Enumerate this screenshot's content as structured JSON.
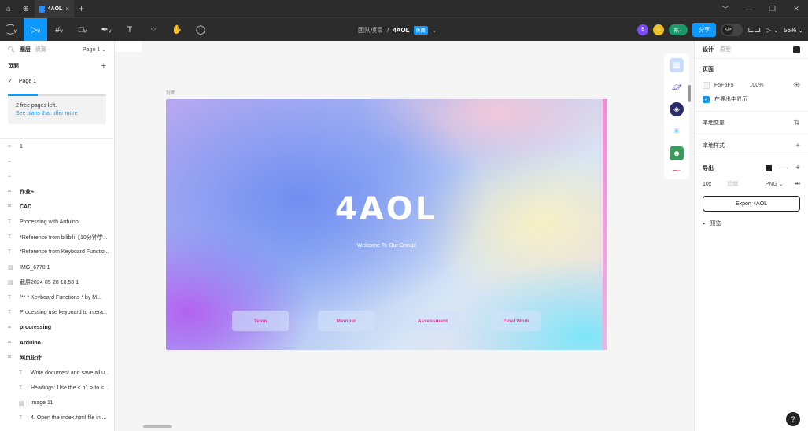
{
  "titlebar": {
    "tab_title": "4AOL"
  },
  "breadcrumb": {
    "team": "团队项目",
    "separator": "/",
    "file": "4AOL",
    "plan_badge": "免费"
  },
  "toolbar": {
    "avatar_b": "B",
    "avatar_user": "陈",
    "share_label": "分享",
    "zoom": "56%"
  },
  "left_panel": {
    "tab_layers": "图层",
    "tab_assets": "资源",
    "page_selector": "Page 1",
    "pages_title": "页面",
    "current_page": "Page 1",
    "upsell_text": "2 free pages left.",
    "upsell_link": "See plans that offer more",
    "layers": [
      {
        "icon": "#",
        "label": "1",
        "bold": false,
        "indent": false
      },
      {
        "icon": "#",
        "label": "",
        "bold": false,
        "indent": false
      },
      {
        "icon": "#",
        "label": "",
        "bold": false,
        "indent": false
      },
      {
        "icon": "#",
        "label": "作业6",
        "bold": true,
        "indent": false
      },
      {
        "icon": "#",
        "label": "CAD",
        "bold": true,
        "indent": false
      },
      {
        "icon": "T",
        "label": "Processing with Arduino",
        "bold": false,
        "indent": false
      },
      {
        "icon": "T",
        "label": "*Reference from bilibili【10分钟学...",
        "bold": false,
        "indent": false
      },
      {
        "icon": "T",
        "label": "*Reference from Keyboard Functio...",
        "bold": false,
        "indent": false
      },
      {
        "icon": "img",
        "label": "IMG_6770 1",
        "bold": false,
        "indent": false
      },
      {
        "icon": "img",
        "label": "截屏2024-05-28 10.50 1",
        "bold": false,
        "indent": false
      },
      {
        "icon": "T",
        "label": "/** * Keyboard Functions * by M...",
        "bold": false,
        "indent": false
      },
      {
        "icon": "T",
        "label": "Processing use keyboard to intera...",
        "bold": false,
        "indent": false
      },
      {
        "icon": "#",
        "label": "procressing",
        "bold": true,
        "indent": false
      },
      {
        "icon": "#",
        "label": "Arduino",
        "bold": true,
        "indent": false
      },
      {
        "icon": "#",
        "label": "网页设计",
        "bold": true,
        "indent": false
      },
      {
        "icon": "T",
        "label": "Write document and save all u...",
        "bold": false,
        "indent": true
      },
      {
        "icon": "T",
        "label": "Headings: Use the < h1 > to <...",
        "bold": false,
        "indent": true
      },
      {
        "icon": "img",
        "label": "image 11",
        "bold": false,
        "indent": true
      },
      {
        "icon": "T",
        "label": "4. Open the index.html file in ...",
        "bold": false,
        "indent": true
      }
    ]
  },
  "canvas": {
    "frame_label": "封面",
    "brand": "4AOL",
    "welcome": "Welcome To Our Group!",
    "buttons": [
      "Team",
      "Member",
      "Assessment",
      "Final Work"
    ]
  },
  "right_panel": {
    "tab_design": "设计",
    "tab_prototype": "原型",
    "page_section": "页面",
    "bg_color": "F5F5F5",
    "bg_opacity": "100%",
    "show_in_export": "在导出中显示",
    "local_variables": "本地变量",
    "local_styles": "本地样式",
    "export_title": "导出",
    "export_scale": "10x",
    "export_suffix_placeholder": "后缀",
    "export_format": "PNG",
    "export_button": "Export 4AOL",
    "preview": "预览"
  },
  "colors": {
    "accent": "#0d99ff",
    "chrome": "#2c2c2c",
    "button_text": "#e23fa6"
  }
}
